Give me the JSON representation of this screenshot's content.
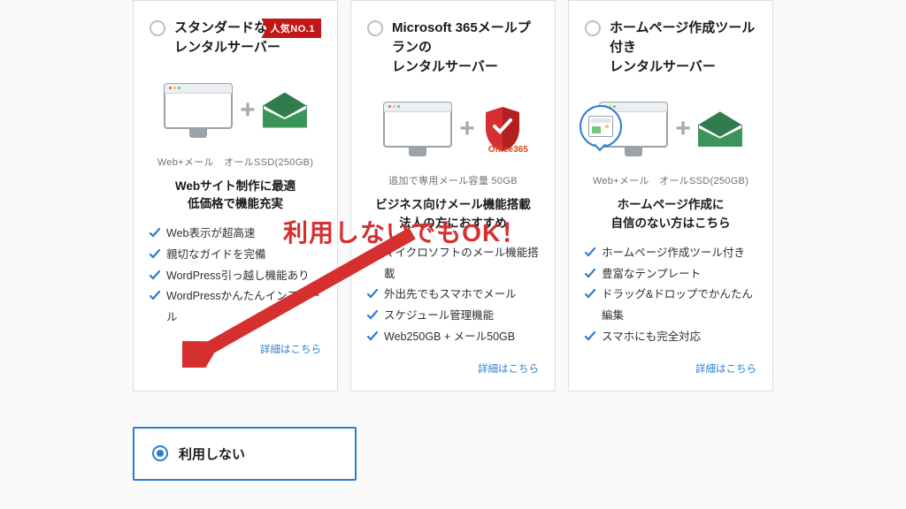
{
  "cards": [
    {
      "title": "スタンダードな\nレンタルサーバー",
      "badge": "人気NO.1",
      "sub": "Web+メール　オールSSD(250GB)",
      "tagline": "Webサイト制作に最適\n低価格で機能充実",
      "features": [
        "Web表示が超高速",
        "親切なガイドを完備",
        "WordPress引っ越し機能あり",
        "WordPressかんたんインストール"
      ],
      "more": "詳細はこちら"
    },
    {
      "title": "Microsoft 365メールプランの\nレンタルサーバー",
      "sub": "追加で専用メール容量 50GB",
      "tagline": "ビジネス向けメール機能搭載\n法人の方におすすめ",
      "features": [
        "マイクロソフトのメール機能搭載",
        "外出先でもスマホでメール",
        "スケジュール管理機能",
        "Web250GB + メール50GB"
      ],
      "more": "詳細はこちら"
    },
    {
      "title": "ホームページ作成ツール付き\nレンタルサーバー",
      "sub": "Web+メール　オールSSD(250GB)",
      "tagline": "ホームページ作成に\n自信のない方はこちら",
      "features": [
        "ホームページ作成ツール付き",
        "豊富なテンプレート",
        "ドラッグ&ドロップでかんたん編集",
        "スマホにも完全対応"
      ],
      "more": "詳細はこちら"
    }
  ],
  "none_option": {
    "label": "利用しない"
  },
  "annotation": "利用しないでもOK！",
  "o365_label": "Office365"
}
